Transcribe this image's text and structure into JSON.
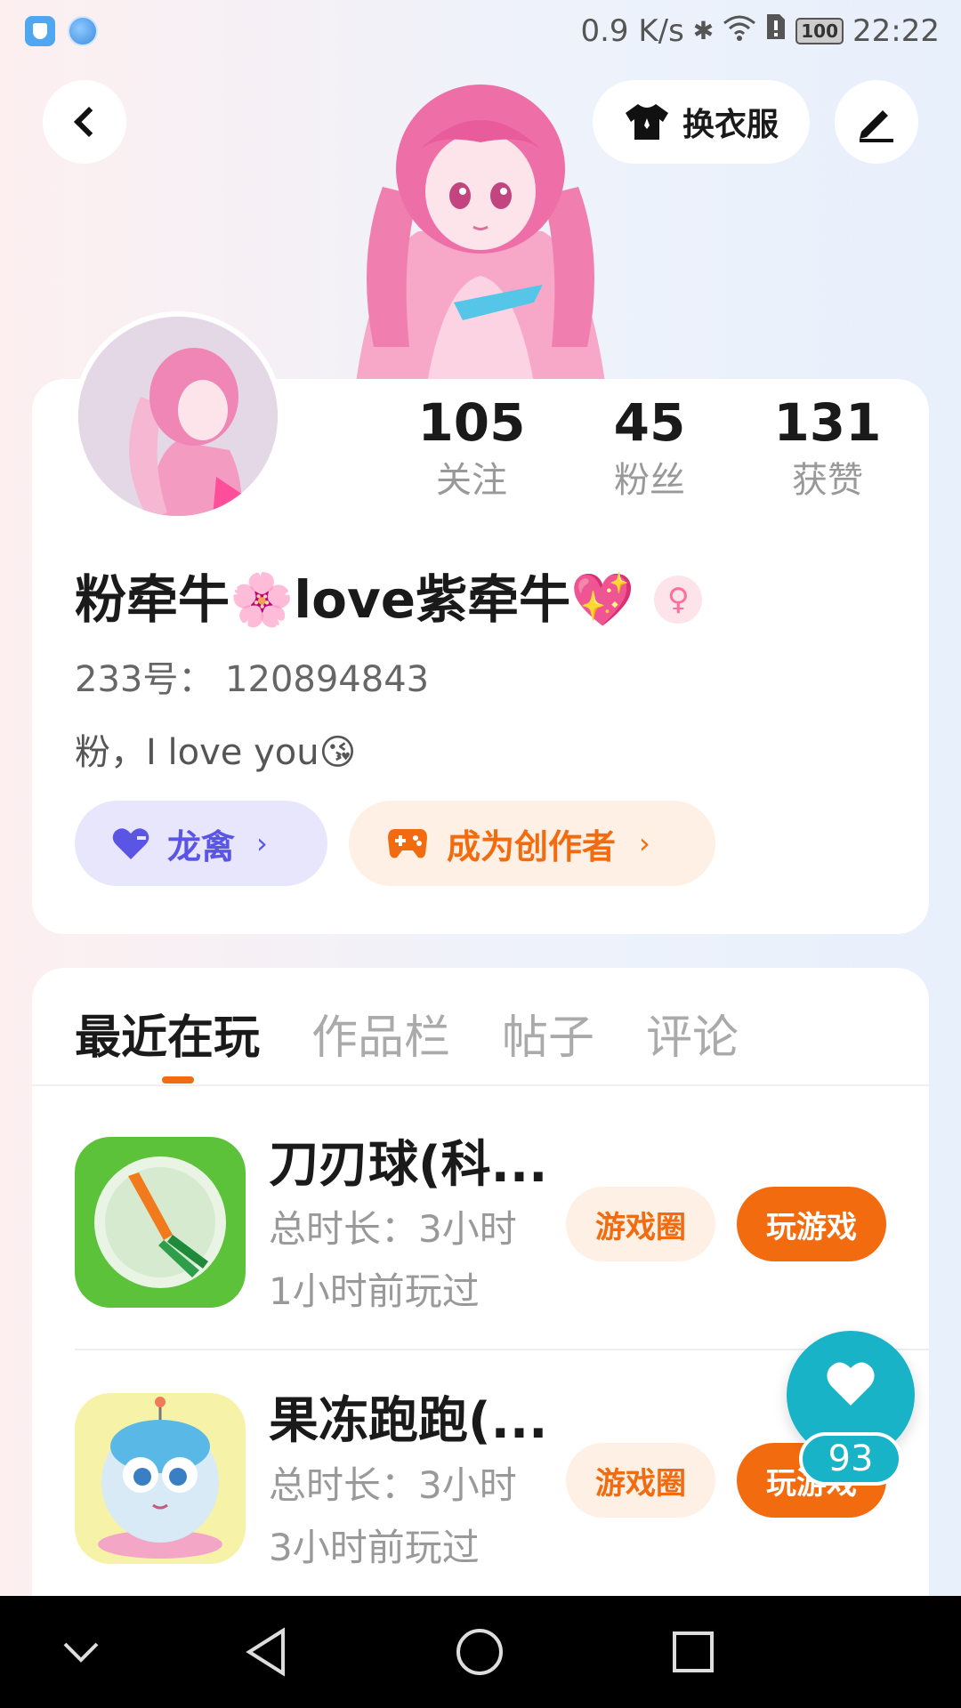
{
  "status_bar": {
    "net_speed": "0.9 K/s",
    "battery": "100",
    "time": "22:22"
  },
  "header": {
    "outfit_label": "换衣服"
  },
  "profile": {
    "stats": [
      {
        "value": "105",
        "label": "关注"
      },
      {
        "value": "45",
        "label": "粉丝"
      },
      {
        "value": "131",
        "label": "获赞"
      }
    ],
    "nickname": "粉牵牛🌸love紫牵牛💖",
    "gender_symbol": "♀",
    "user_id": "233号： 120894843",
    "bio": "粉，I love you😘",
    "guild_label": "龙禽",
    "creator_label": "成为创作者",
    "chip_arrow": "›"
  },
  "tabs": [
    "最近在玩",
    "作品栏",
    "帖子",
    "评论"
  ],
  "games": [
    {
      "title": "刀刃球(科...",
      "duration": "总时长：3小时",
      "last_played": "1小时前玩过",
      "circle_label": "游戏圈",
      "play_label": "玩游戏"
    },
    {
      "title": "果冻跑跑(...",
      "duration": "总时长：3小时",
      "last_played": "3小时前玩过",
      "circle_label": "游戏圈",
      "play_label": "玩游戏"
    }
  ],
  "like_float": {
    "count": "93"
  },
  "colors": {
    "accent_orange": "#f36b0f",
    "guild_purple": "#5b55e6",
    "like_teal": "#19b3c8"
  }
}
